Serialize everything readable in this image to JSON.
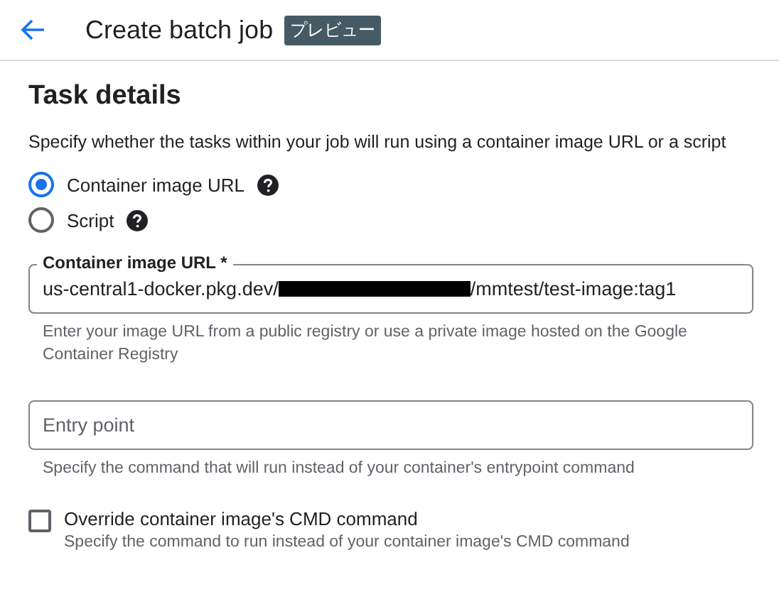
{
  "header": {
    "title": "Create batch job",
    "badge": "プレビュー"
  },
  "section": {
    "title": "Task details",
    "description": "Specify whether the tasks within your job will run using a container image URL or a script"
  },
  "source_options": [
    {
      "label": "Container image URL",
      "selected": true,
      "help": true
    },
    {
      "label": "Script",
      "selected": false,
      "help": true
    }
  ],
  "image_url_field": {
    "label": "Container image URL *",
    "value_parts": [
      "us-central1-docker.pkg.dev/",
      "/mmtest/test-image:tag1"
    ],
    "redacted": true,
    "hint": "Enter your image URL from a public registry or use a private image hosted on the Google Container Registry"
  },
  "entry_point_field": {
    "placeholder": "Entry point",
    "hint": "Specify the command that will run instead of your container's entrypoint command"
  },
  "override_cmd": {
    "label": "Override container image's CMD command",
    "checked": false,
    "hint": "Specify the command to run instead of your container image's CMD command"
  }
}
